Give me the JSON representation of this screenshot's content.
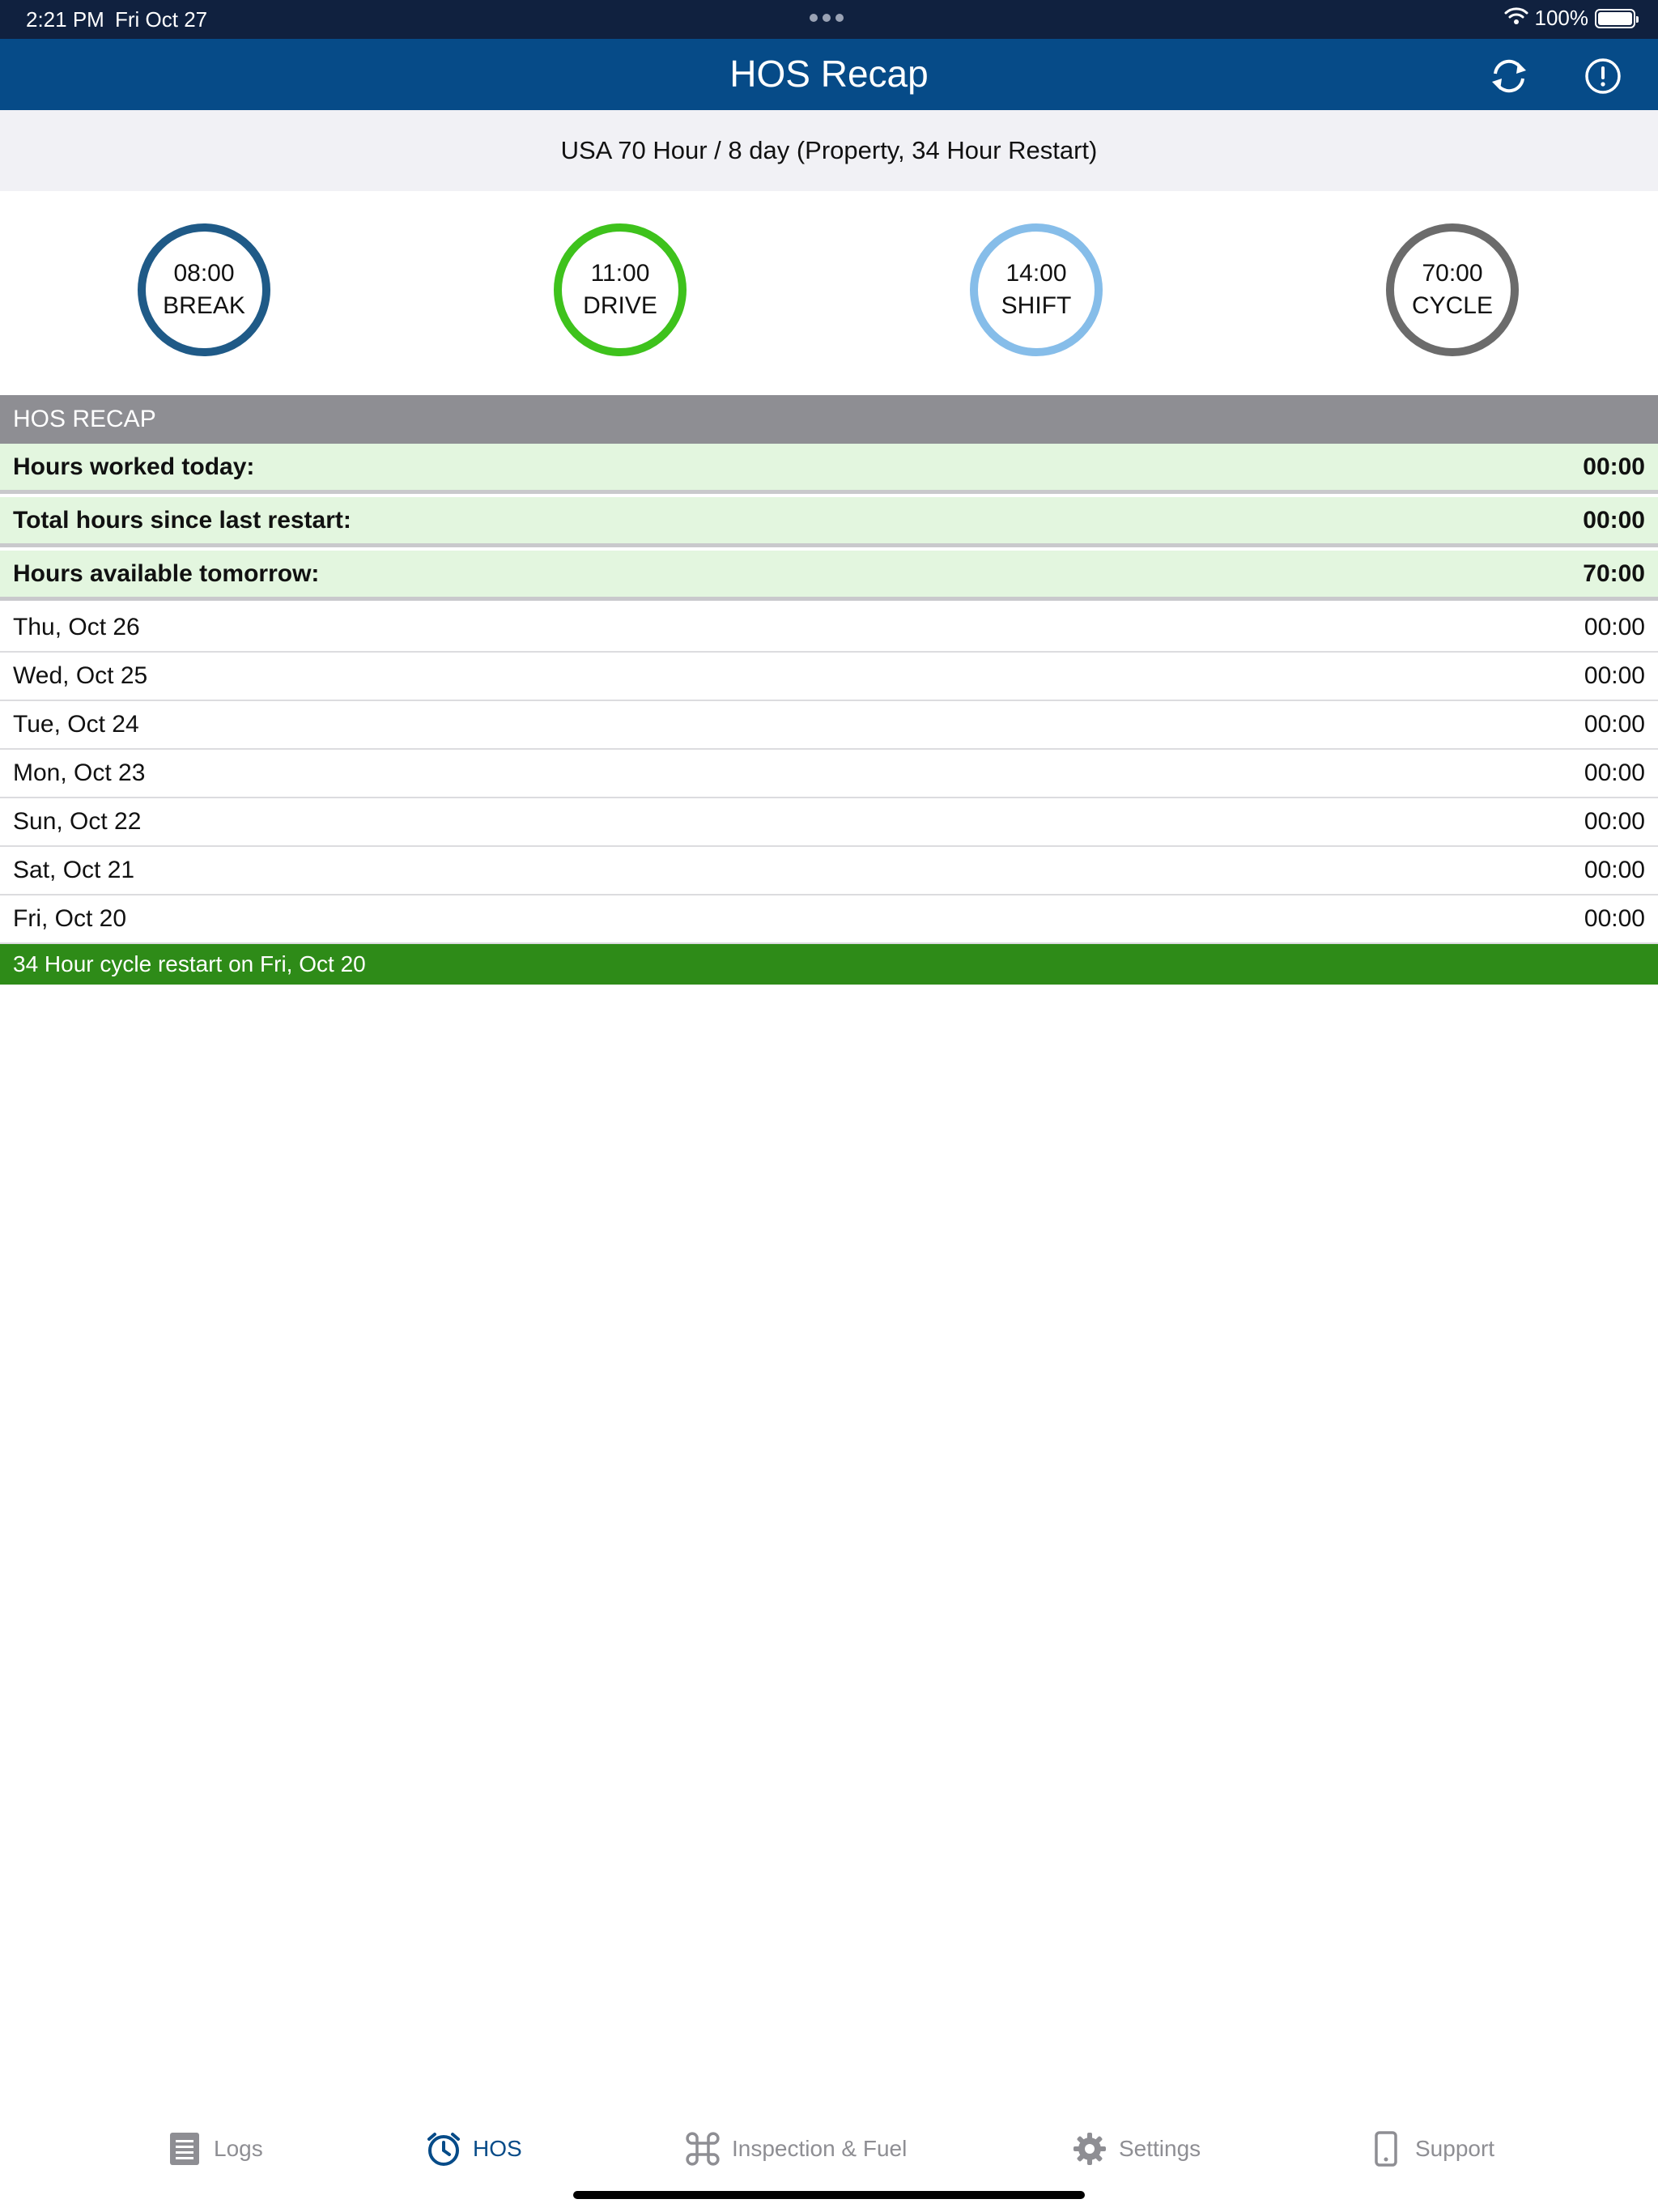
{
  "status_bar": {
    "time": "2:21 PM",
    "date": "Fri Oct 27",
    "battery": "100%",
    "battery_level": 1.0
  },
  "nav": {
    "title": "HOS Recap",
    "refresh_icon": "refresh-icon",
    "info_icon": "info-icon"
  },
  "rule": "USA 70 Hour / 8 day (Property, 34 Hour Restart)",
  "gauges": [
    {
      "value": "08:00",
      "label": "BREAK",
      "color": "#1f5a87"
    },
    {
      "value": "11:00",
      "label": "DRIVE",
      "color": "#3ec21c"
    },
    {
      "value": "14:00",
      "label": "SHIFT",
      "color": "#86bde9"
    },
    {
      "value": "70:00",
      "label": "CYCLE",
      "color": "#6b6b6b"
    }
  ],
  "recap": {
    "header": "HOS RECAP",
    "summary": [
      {
        "label": "Hours worked today:",
        "value": "00:00"
      },
      {
        "label": "Total hours since last restart:",
        "value": "00:00"
      },
      {
        "label": "Hours available tomorrow:",
        "value": "70:00"
      }
    ],
    "days": [
      {
        "label": "Thu, Oct 26",
        "value": "00:00"
      },
      {
        "label": "Wed, Oct 25",
        "value": "00:00"
      },
      {
        "label": "Tue, Oct 24",
        "value": "00:00"
      },
      {
        "label": "Mon, Oct 23",
        "value": "00:00"
      },
      {
        "label": "Sun, Oct 22",
        "value": "00:00"
      },
      {
        "label": "Sat, Oct 21",
        "value": "00:00"
      },
      {
        "label": "Fri, Oct 20",
        "value": "00:00"
      }
    ],
    "restart_note": "34 Hour cycle restart on Fri, Oct 20"
  },
  "tabs": [
    {
      "label": "Logs",
      "icon": "logs-icon",
      "active": false
    },
    {
      "label": "HOS",
      "icon": "clock-icon",
      "active": true
    },
    {
      "label": "Inspection & Fuel",
      "icon": "command-icon",
      "active": false
    },
    {
      "label": "Settings",
      "icon": "gear-icon",
      "active": false
    },
    {
      "label": "Support",
      "icon": "phone-icon",
      "active": false
    }
  ],
  "colors": {
    "nav_background": "#064b88",
    "status_background": "#10213f",
    "summary_background": "#e3f6df",
    "restart_banner": "#2e8b18",
    "active_tab": "#064b88",
    "inactive_tab": "#8e8e93"
  }
}
